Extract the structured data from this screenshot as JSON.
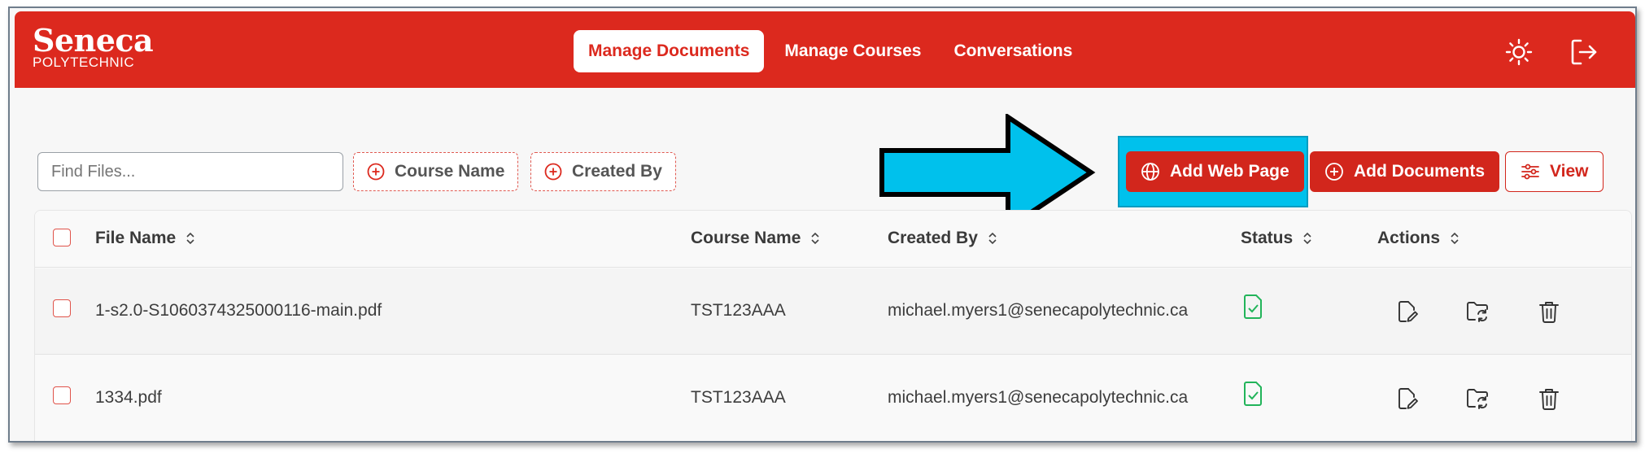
{
  "brand": {
    "line1": "Seneca",
    "line2": "POLYTECHNIC",
    "accent": "#dc291e"
  },
  "nav": {
    "tabs": [
      {
        "label": "Manage Documents",
        "active": true
      },
      {
        "label": "Manage Courses",
        "active": false
      },
      {
        "label": "Conversations",
        "active": false
      }
    ]
  },
  "header_icons": {
    "theme": "sun-icon",
    "logout": "logout-icon"
  },
  "toolbar": {
    "search_placeholder": "Find Files...",
    "filter_course": "Course Name",
    "filter_created": "Created By",
    "add_web_page": "Add Web Page",
    "add_documents": "Add Documents",
    "view": "View"
  },
  "annotation": {
    "arrow_color": "#00c1ec",
    "highlight_target": "add-web-page-button"
  },
  "table": {
    "columns": [
      "File Name",
      "Course Name",
      "Created By",
      "Status",
      "Actions"
    ],
    "rows": [
      {
        "file": "1-s2.0-S1060374325000116-main.pdf",
        "course": "TST123AAA",
        "created_by": "michael.myers1@senecapolytechnic.ca",
        "status": "processed"
      },
      {
        "file": "1334.pdf",
        "course": "TST123AAA",
        "created_by": "michael.myers1@senecapolytechnic.ca",
        "status": "processed"
      }
    ]
  }
}
